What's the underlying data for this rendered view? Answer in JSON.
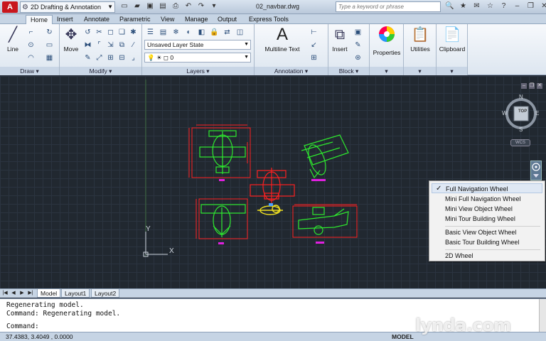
{
  "titlebar": {
    "workspace": "2D Drafting & Annotation",
    "document": "02_navbar.dwg",
    "search_placeholder": "Type a keyword or phrase"
  },
  "ribbon_tabs": [
    "Home",
    "Insert",
    "Annotate",
    "Parametric",
    "View",
    "Manage",
    "Output",
    "Express Tools"
  ],
  "panels": {
    "draw": {
      "title": "Draw",
      "line_label": "Line"
    },
    "modify": {
      "title": "Modify",
      "move_label": "Move"
    },
    "layers": {
      "title": "Layers",
      "layer_state": "Unsaved Layer State",
      "current_layer": "0"
    },
    "annotation": {
      "title": "Annotation",
      "text_label": "Multiline Text"
    },
    "block": {
      "title": "Block",
      "insert_label": "Insert"
    },
    "properties": {
      "label": "Properties"
    },
    "utilities": {
      "label": "Utilities"
    },
    "clipboard": {
      "label": "Clipboard"
    }
  },
  "viewcube": {
    "top": "TOP",
    "north": "N",
    "south": "S",
    "east": "E",
    "west": "W",
    "wcs": "WCS"
  },
  "ucs": {
    "x": "X",
    "y": "Y"
  },
  "context_menu": {
    "items": [
      {
        "label": "Full Navigation Wheel",
        "checked": true
      },
      {
        "label": "Mini Full Navigation Wheel"
      },
      {
        "label": "Mini View Object Wheel"
      },
      {
        "label": "Mini Tour Building Wheel"
      },
      {
        "label": "Basic View Object Wheel"
      },
      {
        "label": "Basic Tour Building Wheel"
      },
      {
        "label": "2D Wheel"
      }
    ]
  },
  "layout_tabs": [
    "Model",
    "Layout1",
    "Layout2"
  ],
  "command_window": {
    "lines": [
      "Regenerating model.",
      "Command:  Regenerating model.",
      "Command:"
    ]
  },
  "status_bar": {
    "coordinates": "37.4383, 3.4049 , 0.0000",
    "model": "MODEL"
  },
  "watermark": "lynda.com",
  "colors": {
    "drawing_red": "#ff2020",
    "drawing_green": "#2ee82e",
    "drawing_magenta": "#e020e0",
    "drawing_yellow": "#f0e020",
    "canvas_bg": "#212830"
  }
}
